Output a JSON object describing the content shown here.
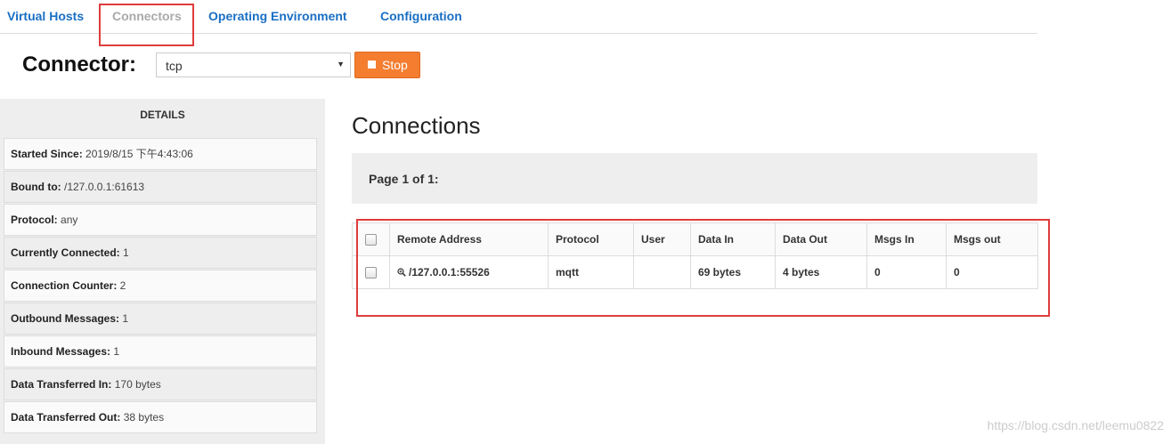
{
  "tabs": [
    {
      "label": "Virtual Hosts"
    },
    {
      "label": "Connectors"
    },
    {
      "label": "Operating Environment"
    },
    {
      "label": "Configuration"
    }
  ],
  "connector": {
    "label": "Connector:",
    "selected": "tcp",
    "stop_label": "Stop"
  },
  "details": {
    "header": "DETAILS",
    "rows": [
      {
        "key": "Started Since:",
        "value": "2019/8/15 下午4:43:06"
      },
      {
        "key": "Bound to:",
        "value": "/127.0.0.1:61613"
      },
      {
        "key": "Protocol:",
        "value": "any"
      },
      {
        "key": "Currently Connected:",
        "value": "1"
      },
      {
        "key": "Connection Counter:",
        "value": "2"
      },
      {
        "key": "Outbound Messages:",
        "value": "1"
      },
      {
        "key": "Inbound Messages:",
        "value": "1"
      },
      {
        "key": "Data Transferred In:",
        "value": "170 bytes"
      },
      {
        "key": "Data Transferred Out:",
        "value": "38 bytes"
      }
    ]
  },
  "connections": {
    "title": "Connections",
    "page_label": "Page 1 of 1:",
    "columns": [
      "Remote Address",
      "Protocol",
      "User",
      "Data In",
      "Data Out",
      "Msgs In",
      "Msgs out"
    ],
    "rows": [
      {
        "remote_address": "/127.0.0.1:55526",
        "protocol": "mqtt",
        "user": "",
        "data_in": "69 bytes",
        "data_out": "4 bytes",
        "msgs_in": "0",
        "msgs_out": "0"
      }
    ]
  },
  "watermark": "https://blog.csdn.net/leemu0822",
  "colors": {
    "link": "#1a6fc4",
    "active_tab": "#aaaaaa",
    "stop_button": "#f47d30",
    "highlight": "#e03c3c",
    "panel_bg": "#eeeeee"
  }
}
